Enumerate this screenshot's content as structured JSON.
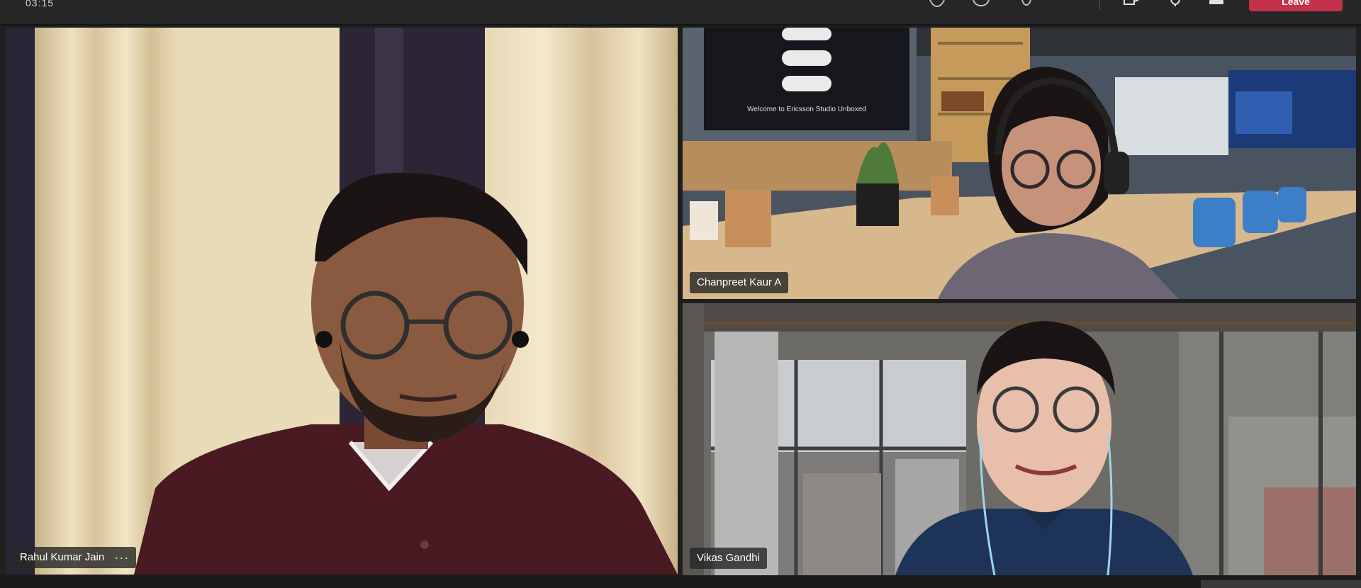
{
  "meeting": {
    "timer": "03:15",
    "leave_label": "Leave"
  },
  "toolbar": {
    "icons": [
      "people-icon",
      "chat-icon",
      "raise-hand-icon",
      "camera-icon",
      "mic-icon",
      "share-icon"
    ]
  },
  "participants": [
    {
      "name": "Rahul Kumar Jain",
      "more": "···"
    },
    {
      "name": "Chanpreet Kaur A"
    },
    {
      "name": "Vikas Gandhi"
    }
  ],
  "scene": {
    "office_screen_text": "Welcome to Ericsson Studio Unboxed"
  },
  "colors": {
    "leave": "#c4314b",
    "background": "#1f1f1f",
    "shirt_maroon": "#4a1a22",
    "shirt_navy": "#1d3458",
    "curtain": "#e6d3ab"
  }
}
